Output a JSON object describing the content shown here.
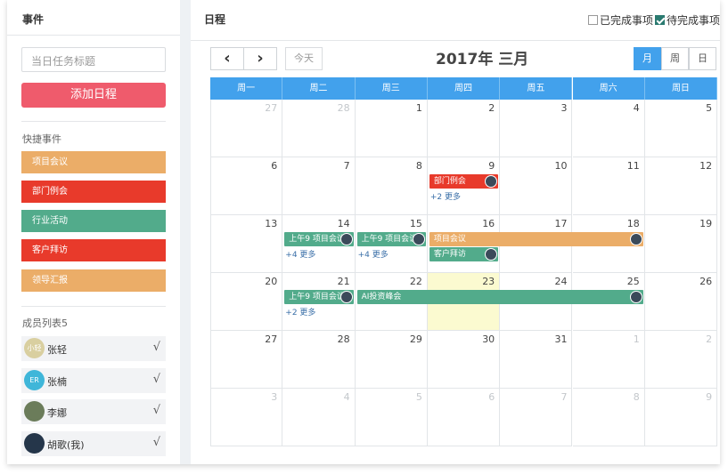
{
  "left": {
    "title": "事件",
    "task_placeholder": "当日任务标题",
    "add_button": "添加日程",
    "quick_title": "快捷事件",
    "quick_events": [
      {
        "label": "项目会议",
        "color": "#ebad68"
      },
      {
        "label": "部门例会",
        "color": "#e83a2b"
      },
      {
        "label": "行业活动",
        "color": "#52ab8b"
      },
      {
        "label": "客户拜访",
        "color": "#e83a2b"
      },
      {
        "label": "领导汇报",
        "color": "#ebad68"
      }
    ],
    "members_title": "成员列表5",
    "members": [
      {
        "name": "张轻",
        "avatar_text": "小轻",
        "avatar_color": "#d9cfa0",
        "check": "√"
      },
      {
        "name": "张楠",
        "avatar_text": "ER",
        "avatar_color": "#3fb6d9",
        "check": "√"
      },
      {
        "name": "李娜",
        "avatar_text": "",
        "avatar_color": "#6b7c5a",
        "check": "√"
      },
      {
        "name": "胡歌(我)",
        "avatar_text": "",
        "avatar_color": "#25364a",
        "check": "√"
      }
    ]
  },
  "right": {
    "title": "日程",
    "filter_done": "已完成事项",
    "filter_todo": "待完成事项",
    "prev_icon": "‹",
    "next_icon": "›",
    "today": "今天",
    "calendar_title": "2017年 三月",
    "views": [
      "月",
      "周",
      "日"
    ],
    "weekdays": [
      "周一",
      "周二",
      "周三",
      "周四",
      "周五",
      "周六",
      "周日"
    ],
    "weeks": [
      [
        "27",
        "28",
        "1",
        "2",
        "3",
        "4",
        "5"
      ],
      [
        "6",
        "7",
        "8",
        "9",
        "10",
        "11",
        "12"
      ],
      [
        "13",
        "14",
        "15",
        "16",
        "17",
        "18",
        "19"
      ],
      [
        "20",
        "21",
        "22",
        "23",
        "24",
        "25",
        "26"
      ],
      [
        "27",
        "28",
        "29",
        "30",
        "31",
        "1",
        "2"
      ],
      [
        "3",
        "4",
        "5",
        "6",
        "7",
        "8",
        "9"
      ]
    ],
    "events": [
      {
        "label": "部门例会",
        "color": "#e83a2b"
      },
      {
        "label": "上午9 项目会议",
        "color": "#52ab8b"
      },
      {
        "label": "上午9 项目会议",
        "color": "#52ab8b"
      },
      {
        "label": "项目会议",
        "color": "#ebad68"
      },
      {
        "label": "客户拜访",
        "color": "#52ab8b"
      },
      {
        "label": "上午9 项目会议",
        "color": "#52ab8b"
      },
      {
        "label": "AI投资峰会",
        "color": "#52ab8b"
      }
    ],
    "more_links": [
      "+2 更多",
      "+4 更多",
      "+4 更多",
      "+2 更多"
    ]
  }
}
